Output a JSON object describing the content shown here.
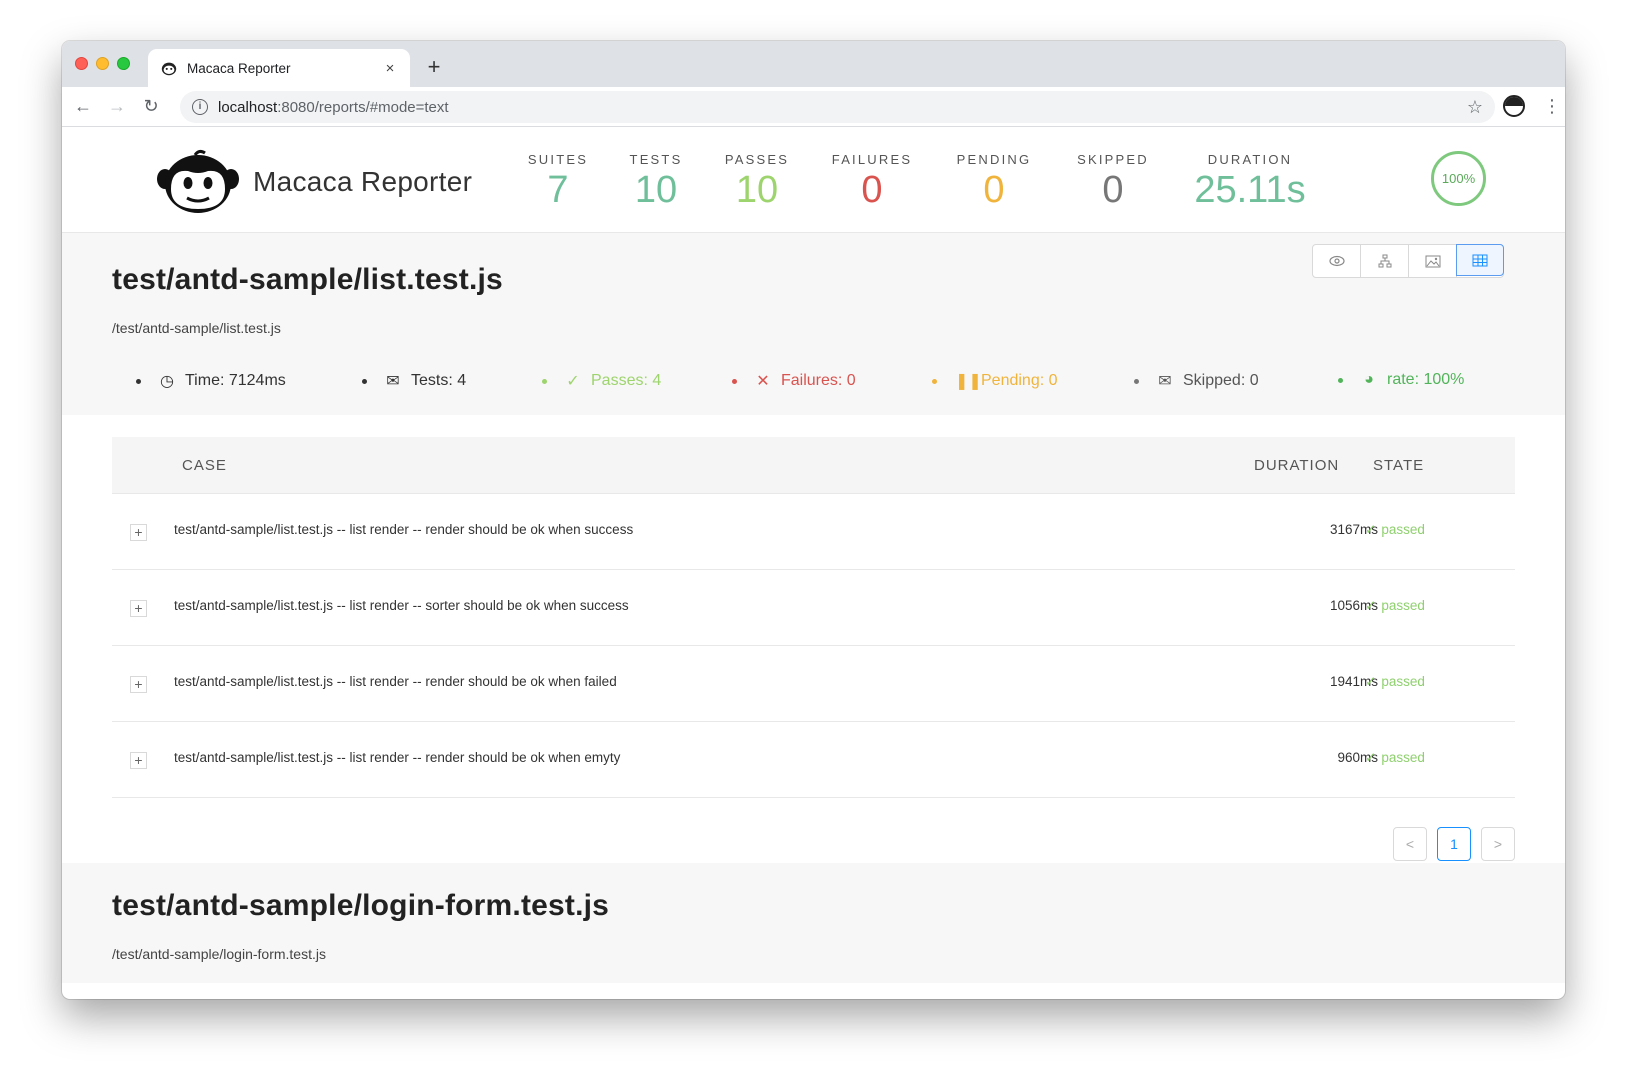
{
  "browser": {
    "tab_title": "Macaca Reporter",
    "url_host": "localhost",
    "url_path": ":8080/reports/#mode=text",
    "new_tab_symbol": "+",
    "close_symbol": "×"
  },
  "header": {
    "brand": "Macaca Reporter",
    "stats": [
      {
        "label": "SUITES",
        "value": "7",
        "color": "#6fbf9a"
      },
      {
        "label": "TESTS",
        "value": "10",
        "color": "#6fbf9a"
      },
      {
        "label": "PASSES",
        "value": "10",
        "color": "#9ed46e"
      },
      {
        "label": "FAILURES",
        "value": "0",
        "color": "#d9534f"
      },
      {
        "label": "PENDING",
        "value": "0",
        "color": "#f0b43c"
      },
      {
        "label": "SKIPPED",
        "value": "0",
        "color": "#777777"
      },
      {
        "label": "DURATION",
        "value": "25.11s",
        "color": "#6fbf9a"
      }
    ],
    "pass_rate": "100%"
  },
  "suites": [
    {
      "title": "test/antd-sample/list.test.js",
      "path": "/test/antd-sample/list.test.js",
      "metrics": {
        "time": "Time: 7124ms",
        "tests": "Tests: 4",
        "passes": "Passes: 4",
        "failures": "Failures: 0",
        "pending": "Pending: 0",
        "skipped": "Skipped: 0",
        "rate": "rate: 100%"
      },
      "table": {
        "col_case": "CASE",
        "col_duration": "DURATION",
        "col_state": "STATE",
        "rows": [
          {
            "case": "test/antd-sample/list.test.js -- list render -- render should be ok when success",
            "duration": "3167ms",
            "state": "passed"
          },
          {
            "case": "test/antd-sample/list.test.js -- list render -- sorter should be ok when success",
            "duration": "1056ms",
            "state": "passed"
          },
          {
            "case": "test/antd-sample/list.test.js -- list render -- render should be ok when failed",
            "duration": "1941ms",
            "state": "passed"
          },
          {
            "case": "test/antd-sample/list.test.js -- list render -- render should be ok when emyty",
            "duration": "960ms",
            "state": "passed"
          }
        ]
      },
      "pagination": {
        "current": "1",
        "prev": "<",
        "next": ">"
      }
    },
    {
      "title": "test/antd-sample/login-form.test.js",
      "path": "/test/antd-sample/login-form.test.js"
    }
  ],
  "colors": {
    "pass": "#9ed46e",
    "fail": "#d9534f",
    "pending": "#f0b43c",
    "neutral": "#777777",
    "accent": "#1890ff",
    "rate": "#52b45a"
  }
}
